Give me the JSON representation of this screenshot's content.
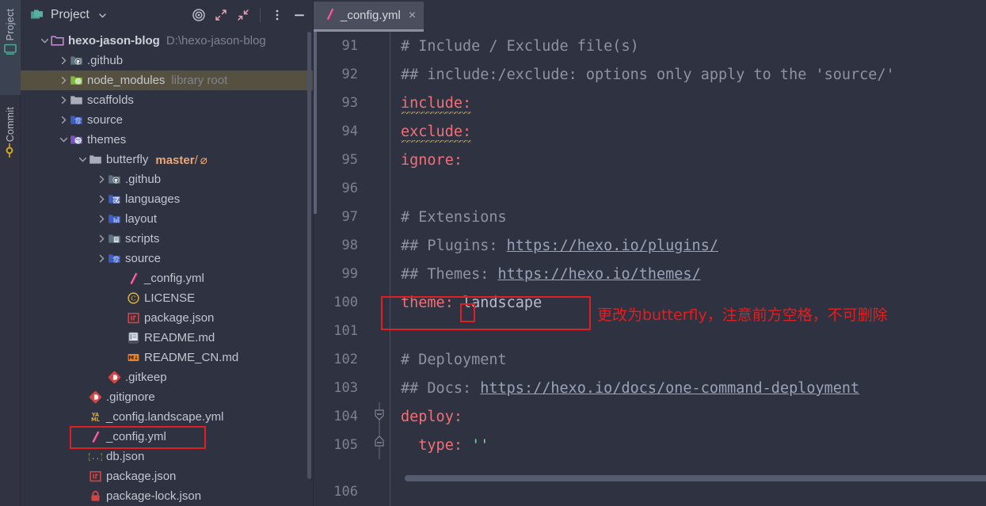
{
  "window": {
    "background": "#2f3240"
  },
  "toolstrip": {
    "items": [
      {
        "label": "Project",
        "icon": "monitor-icon",
        "active": true
      },
      {
        "label": "Commit",
        "icon": "git-commit-icon",
        "active": false
      }
    ]
  },
  "project_panel": {
    "title": "Project",
    "title_chevron": "chevron-down-icon",
    "folder_icon": "folders-icon",
    "actions": [
      {
        "name": "select-opened-file-icon",
        "title": "Select Opened File"
      },
      {
        "name": "expand-all-icon",
        "title": "Expand All"
      },
      {
        "name": "collapse-all-icon",
        "title": "Collapse All"
      },
      {
        "name": "more-options-icon",
        "title": "Options"
      },
      {
        "name": "hide-icon",
        "title": "Hide"
      }
    ],
    "tree": [
      {
        "indent": 0,
        "arrow": "down",
        "icon": "folder-module",
        "label": "hexo-jason-blog",
        "bold": true,
        "meta": "D:\\hexo-jason-blog"
      },
      {
        "indent": 1,
        "arrow": "right",
        "icon": "folder-github",
        "label": ".github"
      },
      {
        "indent": 1,
        "arrow": "right",
        "icon": "folder-node",
        "label": "node_modules",
        "meta": "library root",
        "selected": true
      },
      {
        "indent": 1,
        "arrow": "right",
        "icon": "folder-plain",
        "label": "scaffolds"
      },
      {
        "indent": 1,
        "arrow": "right",
        "icon": "folder-source",
        "label": "source"
      },
      {
        "indent": 1,
        "arrow": "down",
        "icon": "folder-theme",
        "label": "themes"
      },
      {
        "indent": 2,
        "arrow": "down",
        "icon": "folder-plain",
        "label": "butterfly",
        "branch": "master",
        "branch_sep": "/",
        "branch_mark": "⌀"
      },
      {
        "indent": 3,
        "arrow": "right",
        "icon": "folder-github",
        "label": ".github"
      },
      {
        "indent": 3,
        "arrow": "right",
        "icon": "folder-lang",
        "label": "languages"
      },
      {
        "indent": 3,
        "arrow": "right",
        "icon": "folder-layout",
        "label": "layout"
      },
      {
        "indent": 3,
        "arrow": "right",
        "icon": "folder-scripts",
        "label": "scripts"
      },
      {
        "indent": 3,
        "arrow": "right",
        "icon": "folder-source",
        "label": "source"
      },
      {
        "indent": 4,
        "arrow": "none",
        "icon": "file-yml",
        "label": "_config.yml"
      },
      {
        "indent": 4,
        "arrow": "none",
        "icon": "file-license",
        "label": "LICENSE"
      },
      {
        "indent": 4,
        "arrow": "none",
        "icon": "file-npm",
        "label": "package.json"
      },
      {
        "indent": 4,
        "arrow": "none",
        "icon": "file-readme",
        "label": "README.md"
      },
      {
        "indent": 4,
        "arrow": "none",
        "icon": "file-md",
        "label": "README_CN.md"
      },
      {
        "indent": 3,
        "arrow": "none",
        "icon": "file-git",
        "label": ".gitkeep"
      },
      {
        "indent": 2,
        "arrow": "none",
        "icon": "file-git",
        "label": ".gitignore"
      },
      {
        "indent": 2,
        "arrow": "none",
        "icon": "file-yaml",
        "label": "_config.landscape.yml"
      },
      {
        "indent": 2,
        "arrow": "none",
        "icon": "file-yml",
        "label": "_config.yml",
        "highlighted": true
      },
      {
        "indent": 2,
        "arrow": "none",
        "icon": "file-json",
        "label": "db.json"
      },
      {
        "indent": 2,
        "arrow": "none",
        "icon": "file-npm",
        "label": "package.json"
      },
      {
        "indent": 2,
        "arrow": "none",
        "icon": "file-lock",
        "label": "package-lock.json"
      }
    ]
  },
  "editor": {
    "tab": {
      "label": "_config.yml",
      "icon": "file-yml",
      "close": "×"
    },
    "first_partial_line": "90",
    "last_partial_line": "106",
    "lines": [
      {
        "no": "91",
        "segments": [
          {
            "cls": "c-comment",
            "text": "# Include / Exclude file(s)"
          }
        ]
      },
      {
        "no": "92",
        "segments": [
          {
            "cls": "c-comment",
            "text": "## include:/exclude: options only apply to the 'source/'"
          }
        ]
      },
      {
        "no": "93",
        "segments": [
          {
            "cls": "c-key",
            "text": "include:"
          }
        ],
        "squiggle": true
      },
      {
        "no": "94",
        "segments": [
          {
            "cls": "c-key",
            "text": "exclude:"
          }
        ],
        "squiggle": true
      },
      {
        "no": "95",
        "segments": [
          {
            "cls": "c-key",
            "text": "ignore:"
          }
        ]
      },
      {
        "no": "96",
        "segments": []
      },
      {
        "no": "97",
        "segments": [
          {
            "cls": "c-comment",
            "text": "# Extensions"
          }
        ]
      },
      {
        "no": "98",
        "segments": [
          {
            "cls": "c-comment",
            "text": "## Plugins: "
          },
          {
            "cls": "c-link",
            "text": "https://hexo.io/plugins/"
          }
        ]
      },
      {
        "no": "99",
        "segments": [
          {
            "cls": "c-comment",
            "text": "## Themes: "
          },
          {
            "cls": "c-link",
            "text": "https://hexo.io/themes/"
          }
        ]
      },
      {
        "no": "100",
        "segments": [
          {
            "cls": "c-key",
            "text": "theme:"
          },
          {
            "cls": "c-value",
            "text": " landscape"
          }
        ],
        "boxed": true
      },
      {
        "no": "101",
        "segments": []
      },
      {
        "no": "102",
        "segments": [
          {
            "cls": "c-comment",
            "text": "# Deployment"
          }
        ]
      },
      {
        "no": "103",
        "segments": [
          {
            "cls": "c-comment",
            "text": "## Docs: "
          },
          {
            "cls": "c-link",
            "text": "https://hexo.io/docs/one-command-deployment"
          }
        ]
      },
      {
        "no": "104",
        "segments": [
          {
            "cls": "c-key",
            "text": "deploy:"
          }
        ],
        "fold": "open-top"
      },
      {
        "no": "105",
        "segments": [
          {
            "cls": "c-key",
            "text": "  type:"
          },
          {
            "cls": "c-string",
            "text": " ''"
          }
        ],
        "fold": "open-bottom"
      }
    ]
  },
  "annotations": {
    "accent_color": "#e02020",
    "theme_note": "更改为butterfly，注意前方空格，不可删除"
  }
}
